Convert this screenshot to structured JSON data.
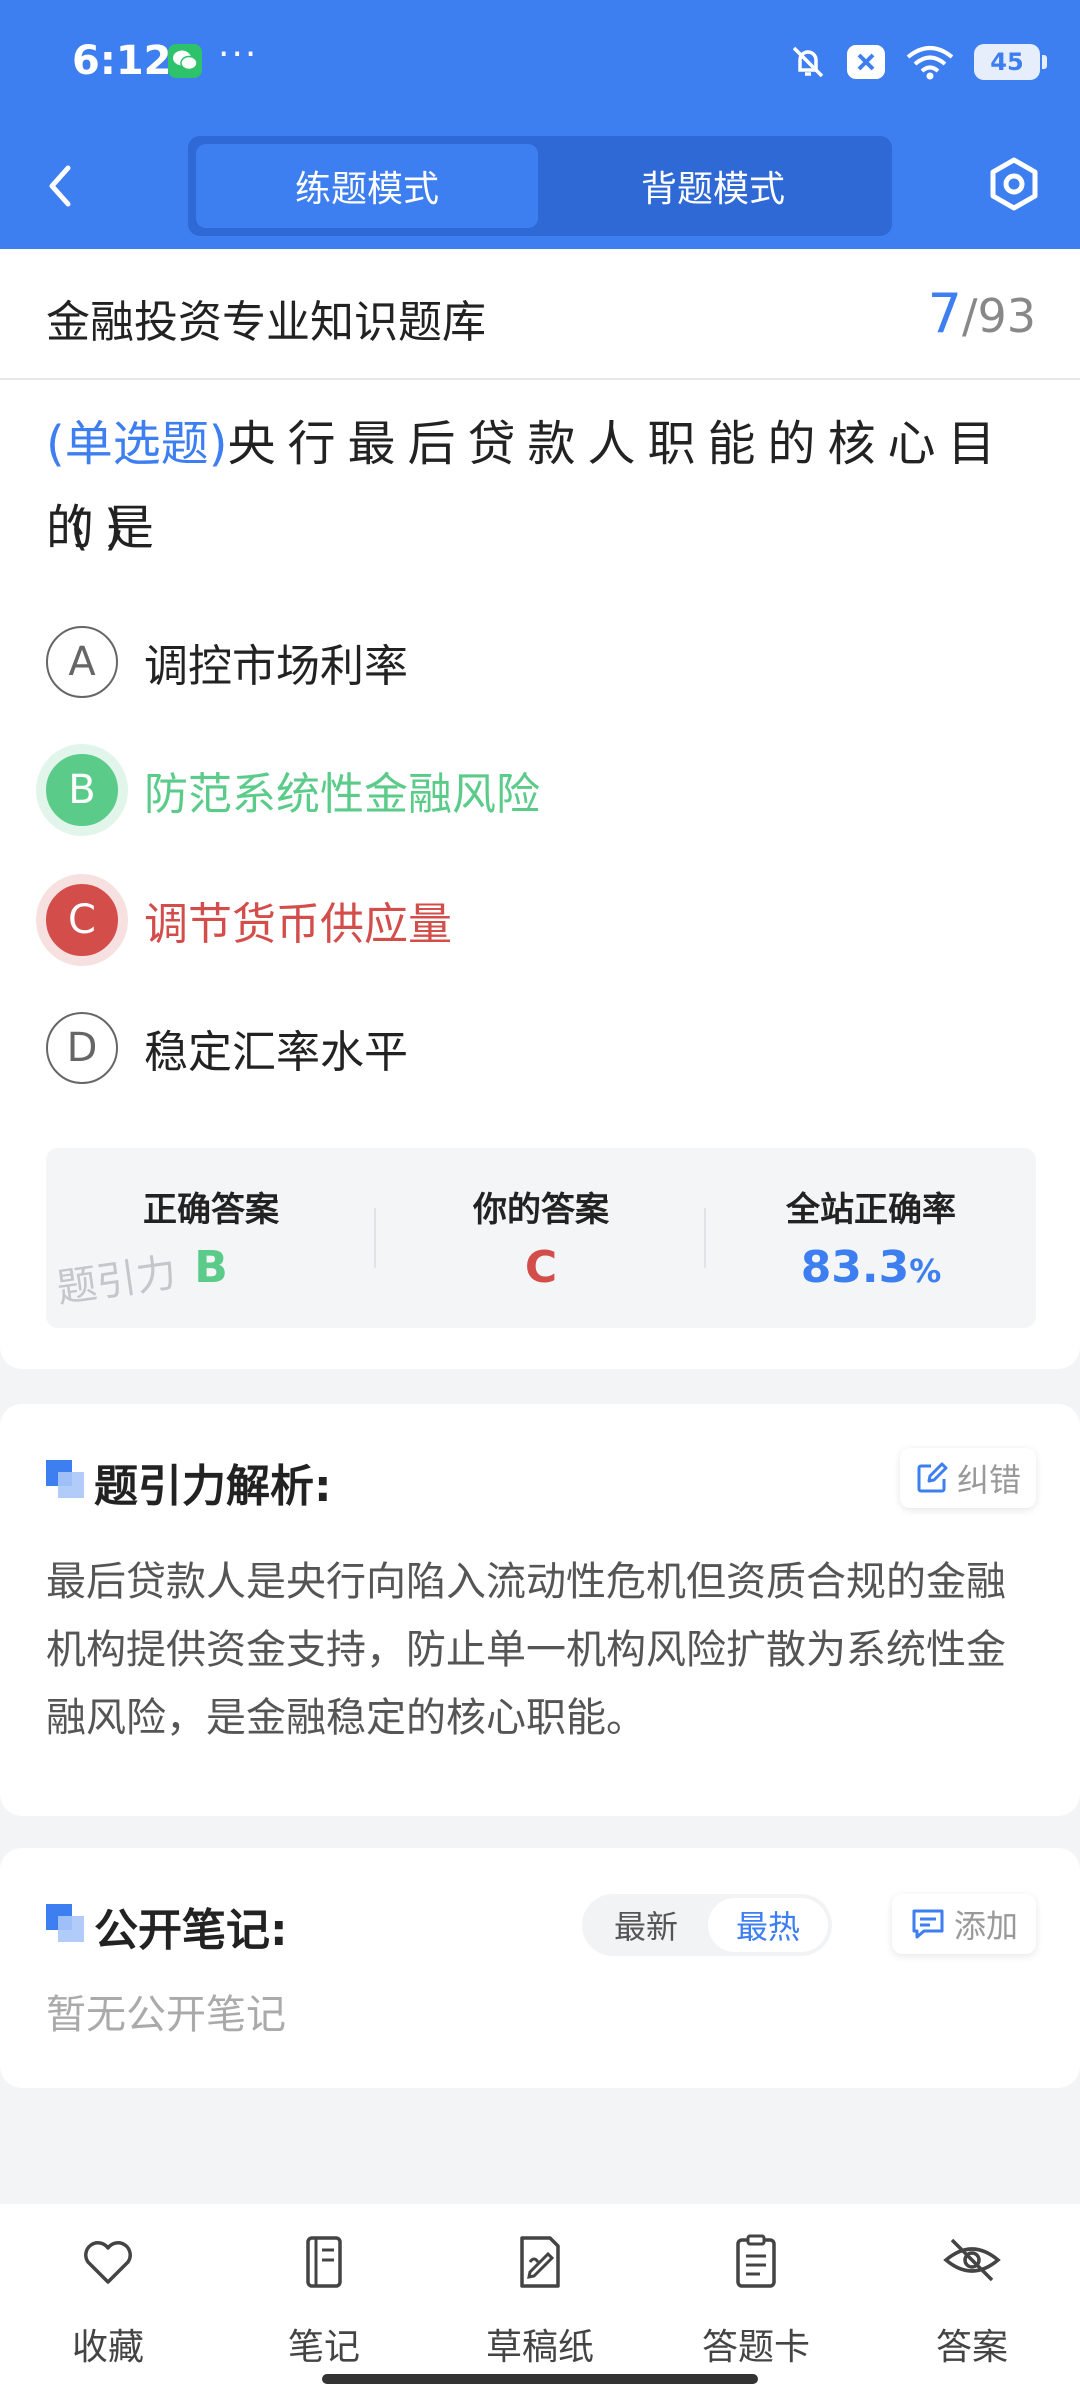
{
  "status_bar": {
    "time": "6:12",
    "dots": "···",
    "battery": "45"
  },
  "header": {
    "tabs": [
      {
        "label": "练题模式",
        "active": true
      },
      {
        "label": "背题模式",
        "active": false
      }
    ]
  },
  "bank": {
    "title": "金融投资专业知识题库",
    "current": "7",
    "total": "/93"
  },
  "question": {
    "type": "(单选题)",
    "text": "央行最后贷款人职能的核心目的是",
    "blank": "(      )"
  },
  "options": [
    {
      "letter": "A",
      "text": "调控市场利率",
      "state": "normal"
    },
    {
      "letter": "B",
      "text": "防范系统性金融风险",
      "state": "correct"
    },
    {
      "letter": "C",
      "text": "调节货币供应量",
      "state": "wrong"
    },
    {
      "letter": "D",
      "text": "稳定汇率水平",
      "state": "normal"
    }
  ],
  "answer_panel": {
    "correct_label": "正确答案",
    "correct_value": "B",
    "yours_label": "你的答案",
    "yours_value": "C",
    "rate_label": "全站正确率",
    "rate_value": "83.3",
    "rate_unit": "%",
    "watermark": "题引力"
  },
  "analysis": {
    "title": "题引力解析:",
    "report_label": "纠错",
    "text": "最后贷款人是央行向陷入流动性危机但资质合规的金融机构提供资金支持，防止单一机构风险扩散为系统性金融风险，是金融稳定的核心职能。"
  },
  "notes": {
    "title": "公开笔记:",
    "sort_latest": "最新",
    "sort_hot": "最热",
    "add_label": "添加",
    "empty": "暂无公开笔记"
  },
  "bottom_nav": [
    {
      "label": "收藏",
      "icon": "heart-icon"
    },
    {
      "label": "笔记",
      "icon": "notebook-icon"
    },
    {
      "label": "草稿纸",
      "icon": "draft-icon"
    },
    {
      "label": "答题卡",
      "icon": "answer-card-icon"
    },
    {
      "label": "答案",
      "icon": "eye-off-icon"
    }
  ],
  "colors": {
    "primary": "#3d7ef0",
    "correct": "#5bcb8a",
    "wrong": "#d34d4a"
  }
}
